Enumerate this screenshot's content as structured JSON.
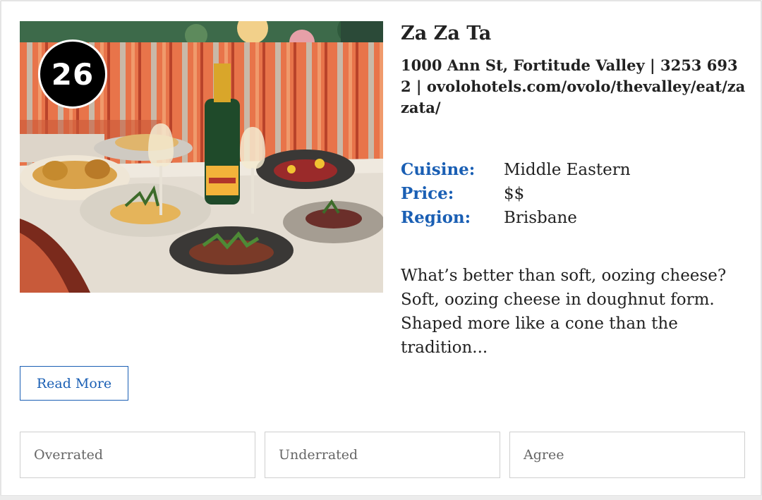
{
  "listing": {
    "rank": "26",
    "name": "Za Za Ta",
    "address_line": "1000 Ann St, Fortitude Valley | 3253 6932 | ovolohotels.com/ovolo/thevalley/eat/zazata/",
    "facts": [
      {
        "label": "Cuisine:",
        "value": "Middle Eastern"
      },
      {
        "label": "Price:",
        "value": "$$"
      },
      {
        "label": "Region:",
        "value": "Brisbane"
      }
    ],
    "excerpt": "What’s better than soft, oozing cheese? Soft, oozing cheese in doughnut form. Shaped more like a cone than the tradition...",
    "read_more_label": "Read More",
    "photo": {
      "description_icon": "restaurant-photo"
    }
  },
  "votes": [
    {
      "label": "Overrated"
    },
    {
      "label": "Underrated"
    },
    {
      "label": "Agree"
    }
  ],
  "colors": {
    "accent": "#1a5fb4",
    "text": "#222222",
    "badge": "#000000",
    "border": "#cfcfcf"
  }
}
